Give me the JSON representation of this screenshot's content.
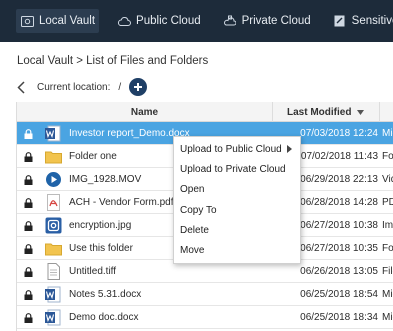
{
  "topnav": {
    "items": [
      {
        "label": "Local Vault",
        "icon": "vault-icon",
        "active": true
      },
      {
        "label": "Public Cloud",
        "icon": "cloud-icon",
        "active": false
      },
      {
        "label": "Private Cloud",
        "icon": "private-cloud-icon",
        "active": false
      },
      {
        "label": "Sensitive",
        "icon": "sensitive-icon",
        "active": false
      }
    ]
  },
  "breadcrumb": "Local Vault > List of Files and Folders",
  "location": {
    "label": "Current location:",
    "path": "/"
  },
  "table": {
    "columns": {
      "name": "Name",
      "modified": "Last Modified",
      "sort_icon": "sort-desc-icon"
    },
    "rows": [
      {
        "name": "Investor report_Demo.docx",
        "modified": "07/03/2018 12:24",
        "type": "Mic",
        "icon": "word-doc-icon",
        "selected": true
      },
      {
        "name": "Folder one",
        "modified": "07/02/2018 11:43",
        "type": "Fol",
        "icon": "folder-icon",
        "selected": false
      },
      {
        "name": "IMG_1928.MOV",
        "modified": "06/29/2018 22:13",
        "type": "Vid",
        "icon": "video-icon",
        "selected": false
      },
      {
        "name": "ACH - Vendor Form.pdf",
        "modified": "06/28/2018 14:28",
        "type": "PD",
        "icon": "pdf-icon",
        "selected": false
      },
      {
        "name": "encryption.jpg",
        "modified": "06/27/2018 10:38",
        "type": "Ima",
        "icon": "image-icon",
        "selected": false
      },
      {
        "name": "Use this folder",
        "modified": "06/27/2018 10:35",
        "type": "Fol",
        "icon": "folder-icon",
        "selected": false
      },
      {
        "name": "Untitled.tiff",
        "modified": "06/26/2018 13:05",
        "type": "File",
        "icon": "file-icon",
        "selected": false
      },
      {
        "name": "Notes 5.31.docx",
        "modified": "06/25/2018 18:54",
        "type": "Mic",
        "icon": "word-doc-icon",
        "selected": false
      },
      {
        "name": "Demo doc.docx",
        "modified": "06/25/2018 18:34",
        "type": "Mic",
        "icon": "word-doc-icon",
        "selected": false
      }
    ]
  },
  "context_menu": {
    "items": [
      {
        "label": "Upload to Public Cloud",
        "has_submenu": true
      },
      {
        "label": "Upload to Private Cloud",
        "has_submenu": false
      },
      {
        "label": "Open",
        "has_submenu": false
      },
      {
        "label": "Copy To",
        "has_submenu": false
      },
      {
        "label": "Delete",
        "has_submenu": false
      },
      {
        "label": "Move",
        "has_submenu": false
      }
    ]
  },
  "colors": {
    "topbar": "#1d2b3a",
    "selected_row": "#4aa4e2",
    "accent_button": "#1f3f66",
    "word_blue": "#2b5797",
    "folder_yellow": "#f2c44e",
    "pdf_red": "#d64541"
  }
}
